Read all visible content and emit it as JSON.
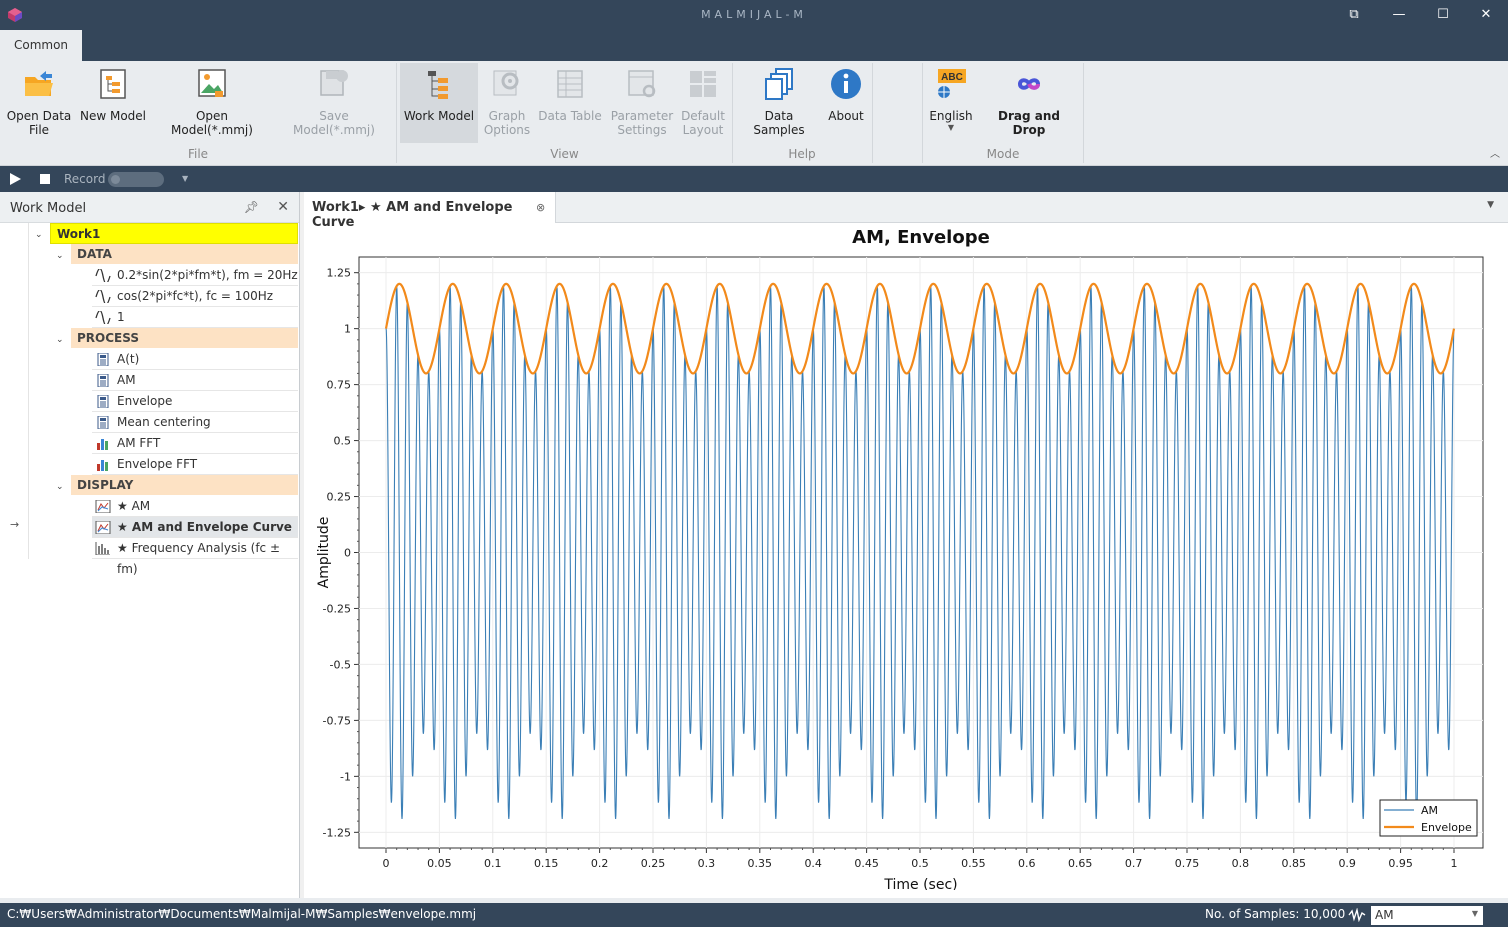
{
  "window": {
    "title": "MALMIJAL-M",
    "controls": [
      "⧉",
      "—",
      "☐",
      "✕"
    ]
  },
  "ribbon": {
    "tab": "Common",
    "buttons": {
      "open_data_file": "Open Data\nFile",
      "new_model": "New Model",
      "open_model": "Open Model(*.mmj)",
      "save_model": "Save Model(*.mmj)",
      "work_model": "Work Model",
      "graph_options": "Graph\nOptions",
      "data_table": "Data Table",
      "parameter_settings": "Parameter\nSettings",
      "default_layout": "Default\nLayout",
      "data_samples": "Data Samples",
      "about": "About",
      "english": "English",
      "drag_and_drop": "Drag and Drop"
    },
    "groups": {
      "file": "File",
      "view": "View",
      "help": "Help",
      "mode": "Mode"
    },
    "lang_badge": "ABC"
  },
  "toolbar": {
    "record_label": "Record"
  },
  "work_model_panel": {
    "title": "Work Model",
    "root": "Work1",
    "categories": {
      "data": "DATA",
      "process": "PROCESS",
      "display": "DISPLAY"
    },
    "data_items": [
      "0.2*sin(2*pi*fm*t), fm = 20Hz",
      "cos(2*pi*fc*t), fc = 100Hz",
      "1"
    ],
    "process_items": [
      "A(t)",
      "AM",
      "Envelope",
      "Mean centering",
      "AM FFT",
      "Envelope FFT"
    ],
    "display_items": [
      "★ AM",
      "★ AM and Envelope Curve",
      "★ Frequency Analysis (fc ± fm)"
    ]
  },
  "document_tab": {
    "label": "Work1▸ ★ AM and Envelope Curve"
  },
  "chart_data": {
    "type": "line",
    "title": "AM, Envelope",
    "xlabel": "Time (sec)",
    "ylabel": "Amplitude",
    "xlim": [
      0,
      1
    ],
    "ylim": [
      -1.32,
      1.32
    ],
    "xticks": [
      "0",
      "0.05",
      "0.1",
      "0.15",
      "0.2",
      "0.25",
      "0.3",
      "0.35",
      "0.4",
      "0.45",
      "0.5",
      "0.55",
      "0.6",
      "0.65",
      "0.7",
      "0.75",
      "0.8",
      "0.85",
      "0.9",
      "0.95",
      "1"
    ],
    "yticks": [
      "1.25",
      "1",
      "0.75",
      "0.5",
      "0.25",
      "0",
      "-0.25",
      "-0.5",
      "-0.75",
      "-1",
      "-1.25"
    ],
    "series": [
      {
        "name": "AM",
        "color": "#3b7fb6",
        "formula": "(1 + 0.2*sin(2*pi*20*t)) * cos(2*pi*100*t)"
      },
      {
        "name": "Envelope",
        "color": "#f28a1b",
        "formula": "1 + 0.2*sin(2*pi*20*t)"
      }
    ],
    "legend": "bottom-right",
    "grid": true
  },
  "statusbar": {
    "path": "C:₩Users₩Administrator₩Documents₩Malmijal-M₩Samples₩envelope.mmj",
    "samples": "No. of Samples: 10,000",
    "selected_series": "AM"
  }
}
